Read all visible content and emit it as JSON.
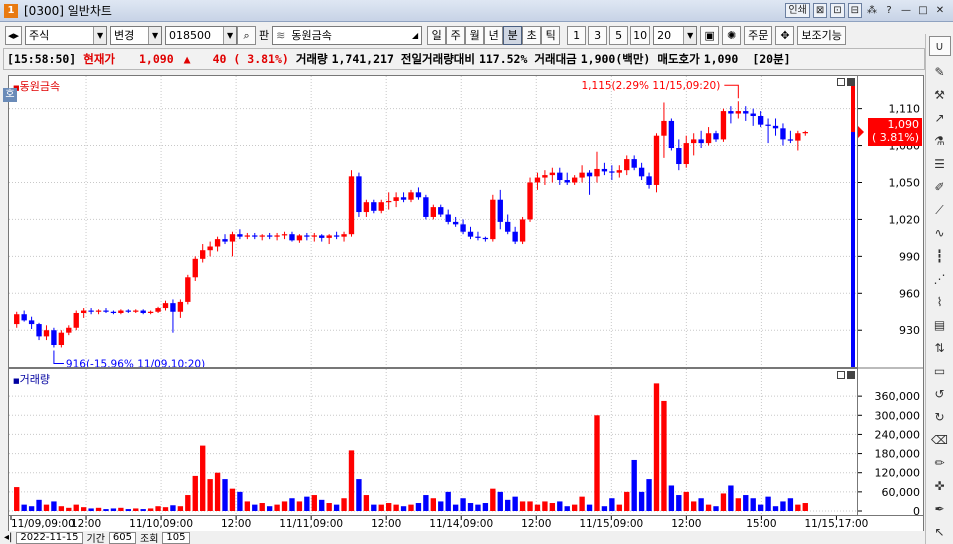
{
  "window": {
    "code_prefix": "[0300]",
    "title": "일반차트",
    "controls": [
      "인쇄",
      "⊠",
      "⊡",
      "⊟",
      "⁂",
      "?",
      "—",
      "□",
      "✕"
    ]
  },
  "toolbar": {
    "market_select": "주식",
    "change_select": "변경",
    "stock_code": "018500",
    "search_icon_label": "🔍",
    "pan_label": "판",
    "stock_name": "동원금속",
    "periods": [
      "일",
      "주",
      "월",
      "년",
      "분",
      "초",
      "틱"
    ],
    "period_active": "분",
    "intervals": [
      "1",
      "3",
      "5",
      "10"
    ],
    "count_value": "20",
    "order_button": "주문",
    "aux_button": "보조기능"
  },
  "infobar": {
    "time": "[15:58:50]",
    "label_price": "현재가",
    "price": "1,090",
    "arrow": "▲",
    "change": "40",
    "change_pct": "( 3.81%)",
    "volume_label": "거래량",
    "volume": "1,741,217",
    "prev_vol_label": "전일거래량대비",
    "prev_vol_ratio": "117.52%",
    "amount_label": "거래대금",
    "amount": "1,900(백만)",
    "ask_label": "매도호가",
    "ask": "1,090",
    "period": "[20분]"
  },
  "price_pane": {
    "title": "동원금속",
    "icon_label": "호",
    "high_annotation": "1,115(2.29% 11/15,09:20)",
    "low_annotation": "916(-15.96% 11/09,10:20)",
    "current_tag_price": "1,090",
    "current_tag_pct": "( 3.81%)"
  },
  "volume_pane": {
    "title": "거래량"
  },
  "bottom": {
    "date_value": "2022-11-15",
    "period_label": "기간",
    "period_value": "605",
    "view_label": "조회",
    "view_value": "105"
  },
  "colors": {
    "up": "#ff0000",
    "down": "#0000ff",
    "grid": "#c8c8c8"
  },
  "chart_data": [
    {
      "type": "candlestick",
      "title": "동원금속",
      "ylim": [
        905,
        1130
      ],
      "yticks": [
        930,
        960,
        990,
        1020,
        1050,
        1080,
        1110
      ],
      "ytick_labels": [
        "930",
        "960",
        "990",
        "1,020",
        "1,050",
        "1,080",
        "1,110"
      ],
      "grid": true,
      "x_labels": [
        "11/09,09:00",
        "12:00",
        "11/10,09:00",
        "12:00",
        "11/11,09:00",
        "12:00",
        "11/14,09:00",
        "12:00",
        "11/15,09:00",
        "12:00",
        "15:00",
        "11/15,17:00"
      ],
      "ohlc": [
        [
          935,
          945,
          932,
          943
        ],
        [
          943,
          946,
          937,
          938
        ],
        [
          938,
          941,
          931,
          935
        ],
        [
          935,
          936,
          922,
          925
        ],
        [
          925,
          934,
          922,
          930
        ],
        [
          930,
          932,
          916,
          918
        ],
        [
          918,
          930,
          916,
          928
        ],
        [
          928,
          934,
          926,
          932
        ],
        [
          932,
          946,
          930,
          944
        ],
        [
          944,
          948,
          940,
          946
        ],
        [
          946,
          948,
          943,
          945
        ],
        [
          945,
          947,
          943,
          946
        ],
        [
          946,
          948,
          944,
          945
        ],
        [
          945,
          946,
          943,
          944
        ],
        [
          944,
          947,
          943,
          946
        ],
        [
          946,
          947,
          944,
          945
        ],
        [
          945,
          947,
          944,
          946
        ],
        [
          946,
          947,
          943,
          944
        ],
        [
          944,
          946,
          943,
          945
        ],
        [
          945,
          949,
          944,
          948
        ],
        [
          948,
          954,
          946,
          952
        ],
        [
          952,
          955,
          928,
          945
        ],
        [
          945,
          955,
          940,
          953
        ],
        [
          953,
          975,
          951,
          973
        ],
        [
          973,
          990,
          970,
          988
        ],
        [
          988,
          1000,
          985,
          995
        ],
        [
          995,
          1002,
          990,
          998
        ],
        [
          998,
          1006,
          994,
          1004
        ],
        [
          1004,
          1008,
          1000,
          1002
        ],
        [
          1002,
          1010,
          990,
          1008
        ],
        [
          1008,
          1012,
          1004,
          1006
        ],
        [
          1006,
          1009,
          1004,
          1007
        ],
        [
          1007,
          1009,
          1004,
          1006
        ],
        [
          1006,
          1008,
          1003,
          1007
        ],
        [
          1007,
          1009,
          1004,
          1006
        ],
        [
          1006,
          1009,
          1003,
          1007
        ],
        [
          1007,
          1010,
          1004,
          1008
        ],
        [
          1008,
          1010,
          1002,
          1003
        ],
        [
          1003,
          1008,
          1001,
          1007
        ],
        [
          1007,
          1009,
          1003,
          1006
        ],
        [
          1006,
          1009,
          1002,
          1007
        ],
        [
          1007,
          1008,
          1002,
          1005
        ],
        [
          1005,
          1008,
          1000,
          1007
        ],
        [
          1007,
          1010,
          1004,
          1006
        ],
        [
          1006,
          1010,
          1002,
          1008
        ],
        [
          1008,
          1060,
          1006,
          1055
        ],
        [
          1055,
          1058,
          1022,
          1026
        ],
        [
          1026,
          1036,
          1022,
          1034
        ],
        [
          1034,
          1036,
          1025,
          1027
        ],
        [
          1027,
          1036,
          1025,
          1034
        ],
        [
          1034,
          1042,
          1028,
          1035
        ],
        [
          1035,
          1042,
          1030,
          1038
        ],
        [
          1038,
          1042,
          1034,
          1036
        ],
        [
          1036,
          1044,
          1034,
          1042
        ],
        [
          1042,
          1046,
          1036,
          1038
        ],
        [
          1038,
          1040,
          1020,
          1022
        ],
        [
          1022,
          1032,
          1020,
          1030
        ],
        [
          1030,
          1032,
          1022,
          1024
        ],
        [
          1024,
          1028,
          1016,
          1018
        ],
        [
          1018,
          1022,
          1014,
          1016
        ],
        [
          1016,
          1020,
          1008,
          1010
        ],
        [
          1010,
          1014,
          1004,
          1006
        ],
        [
          1006,
          1010,
          1003,
          1005
        ],
        [
          1005,
          1006,
          1002,
          1004
        ],
        [
          1004,
          1040,
          1002,
          1036
        ],
        [
          1036,
          1044,
          1012,
          1018
        ],
        [
          1018,
          1024,
          1008,
          1010
        ],
        [
          1010,
          1014,
          1000,
          1002
        ],
        [
          1002,
          1022,
          1000,
          1020
        ],
        [
          1020,
          1054,
          1018,
          1050
        ],
        [
          1050,
          1058,
          1044,
          1054
        ],
        [
          1054,
          1060,
          1048,
          1056
        ],
        [
          1056,
          1062,
          1050,
          1058
        ],
        [
          1058,
          1062,
          1048,
          1052
        ],
        [
          1052,
          1058,
          1048,
          1050
        ],
        [
          1050,
          1056,
          1048,
          1054
        ],
        [
          1054,
          1064,
          1050,
          1058
        ],
        [
          1058,
          1060,
          1040,
          1055
        ],
        [
          1055,
          1075,
          1050,
          1061
        ],
        [
          1061,
          1066,
          1056,
          1059
        ],
        [
          1059,
          1064,
          1052,
          1058
        ],
        [
          1058,
          1064,
          1054,
          1060
        ],
        [
          1060,
          1072,
          1056,
          1069
        ],
        [
          1069,
          1072,
          1060,
          1062
        ],
        [
          1062,
          1066,
          1052,
          1055
        ],
        [
          1055,
          1058,
          1045,
          1048
        ],
        [
          1048,
          1090,
          1042,
          1088
        ],
        [
          1088,
          1115,
          1070,
          1100
        ],
        [
          1100,
          1102,
          1076,
          1078
        ],
        [
          1078,
          1085,
          1060,
          1065
        ],
        [
          1065,
          1088,
          1062,
          1082
        ],
        [
          1082,
          1090,
          1072,
          1085
        ],
        [
          1085,
          1092,
          1078,
          1082
        ],
        [
          1082,
          1095,
          1080,
          1090
        ],
        [
          1090,
          1092,
          1083,
          1085
        ],
        [
          1085,
          1110,
          1083,
          1108
        ],
        [
          1108,
          1112,
          1098,
          1106
        ],
        [
          1106,
          1116,
          1102,
          1108
        ],
        [
          1108,
          1112,
          1100,
          1106
        ],
        [
          1106,
          1110,
          1096,
          1104
        ],
        [
          1104,
          1108,
          1095,
          1097
        ],
        [
          1097,
          1102,
          1082,
          1096
        ],
        [
          1096,
          1102,
          1088,
          1094
        ],
        [
          1094,
          1098,
          1080,
          1085
        ],
        [
          1085,
          1092,
          1082,
          1084
        ],
        [
          1084,
          1092,
          1076,
          1090
        ],
        [
          1090,
          1092,
          1088,
          1091
        ]
      ]
    },
    {
      "type": "bar",
      "title": "거래량",
      "ylim": [
        0,
        420000
      ],
      "yticks": [
        0,
        60000,
        120000,
        180000,
        240000,
        300000,
        360000
      ],
      "ytick_labels": [
        "0",
        "60,000",
        "120,000",
        "180,000",
        "240,000",
        "300,000",
        "360,000"
      ],
      "grid": true,
      "values": [
        75000,
        20000,
        15000,
        35000,
        20000,
        30000,
        15000,
        10000,
        20000,
        12000,
        8000,
        10000,
        6000,
        8000,
        10000,
        6000,
        8000,
        6000,
        8000,
        15000,
        12000,
        18000,
        15000,
        50000,
        110000,
        205000,
        100000,
        120000,
        100000,
        70000,
        60000,
        30000,
        20000,
        25000,
        15000,
        20000,
        30000,
        40000,
        30000,
        45000,
        50000,
        35000,
        25000,
        20000,
        40000,
        190000,
        100000,
        50000,
        20000,
        20000,
        25000,
        20000,
        15000,
        20000,
        25000,
        50000,
        40000,
        30000,
        60000,
        20000,
        40000,
        25000,
        20000,
        25000,
        70000,
        60000,
        35000,
        45000,
        30000,
        30000,
        20000,
        30000,
        25000,
        30000,
        15000,
        20000,
        45000,
        20000,
        300000,
        15000,
        40000,
        20000,
        60000,
        160000,
        60000,
        100000,
        400000,
        345000,
        80000,
        50000,
        60000,
        30000,
        40000,
        20000,
        15000,
        55000,
        80000,
        40000,
        50000,
        40000,
        20000,
        45000,
        15000,
        30000,
        40000,
        20000,
        25000
      ]
    }
  ]
}
